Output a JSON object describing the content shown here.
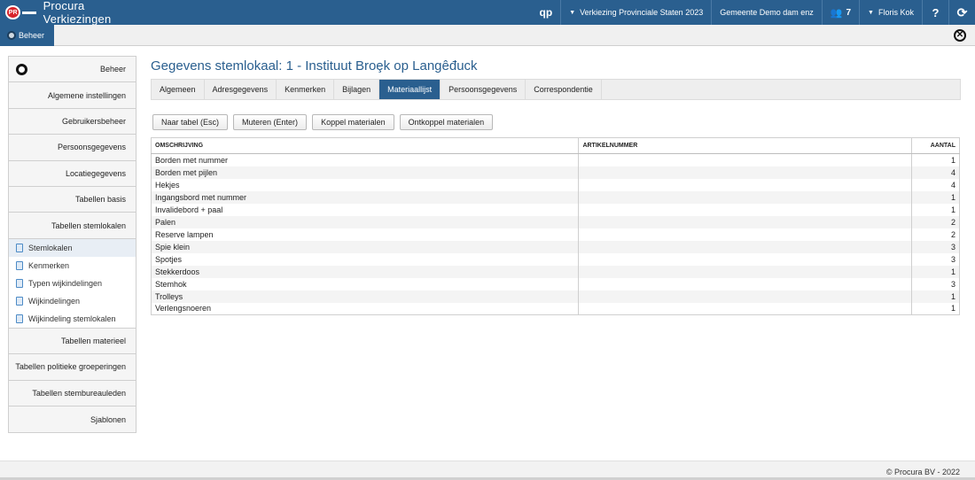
{
  "app": {
    "logo_badge": "PR",
    "title": "Procura Verkiezingen"
  },
  "topbar": {
    "flag_icon": "qp",
    "election": "Verkiezing Provinciale Staten 2023",
    "municipality": "Gemeente Demo dam enz",
    "users_count": "7",
    "user": "Floris Kok",
    "help": "?",
    "logout_icon": "logout-arrow"
  },
  "subbar": {
    "tab_label": "Beheer"
  },
  "sidebar": {
    "head": "Beheer",
    "items_top": [
      "Algemene instellingen",
      "Gebruikersbeheer",
      "Persoonsgegevens",
      "Locatiegegevens",
      "Tabellen basis",
      "Tabellen stemlokalen"
    ],
    "sub_items": [
      "Stemlokalen",
      "Kenmerken",
      "Typen wijkindelingen",
      "Wijkindelingen",
      "Wijkindeling stemlokalen"
    ],
    "items_bottom": [
      "Tabellen materieel",
      "Tabellen politieke groeperingen",
      "Tabellen stembureauleden",
      "Sjablonen"
    ]
  },
  "main": {
    "title": "Gegevens stemlokaal: 1 - Instituut Broȩk op Langêđuck",
    "tabs": [
      "Algemeen",
      "Adresgegevens",
      "Kenmerken",
      "Bijlagen",
      "Materiaallijst",
      "Persoonsgegevens",
      "Correspondentie"
    ],
    "active_tab": "Materiaallijst",
    "buttons": [
      "Naar tabel (Esc)",
      "Muteren (Enter)",
      "Koppel materialen",
      "Ontkoppel materialen"
    ]
  },
  "table": {
    "headers": [
      "OMSCHRIJVING",
      "ARTIKELNUMMER",
      "AANTAL"
    ],
    "rows": [
      [
        "Borden met nummer",
        "",
        "1"
      ],
      [
        "Borden met pijlen",
        "",
        "4"
      ],
      [
        "Hekjes",
        "",
        "4"
      ],
      [
        "Ingangsbord met nummer",
        "",
        "1"
      ],
      [
        "Invalidebord + paal",
        "",
        "1"
      ],
      [
        "Palen",
        "",
        "2"
      ],
      [
        "Reserve lampen",
        "",
        "2"
      ],
      [
        "Spie klein",
        "",
        "3"
      ],
      [
        "Spotjes",
        "",
        "3"
      ],
      [
        "Stekkerdoos",
        "",
        "1"
      ],
      [
        "Stemhok",
        "",
        "3"
      ],
      [
        "Trolleys",
        "",
        "1"
      ],
      [
        "Verlengsnoeren",
        "",
        "1"
      ]
    ]
  },
  "footer": {
    "copyright": "© Procura BV - 2022"
  }
}
